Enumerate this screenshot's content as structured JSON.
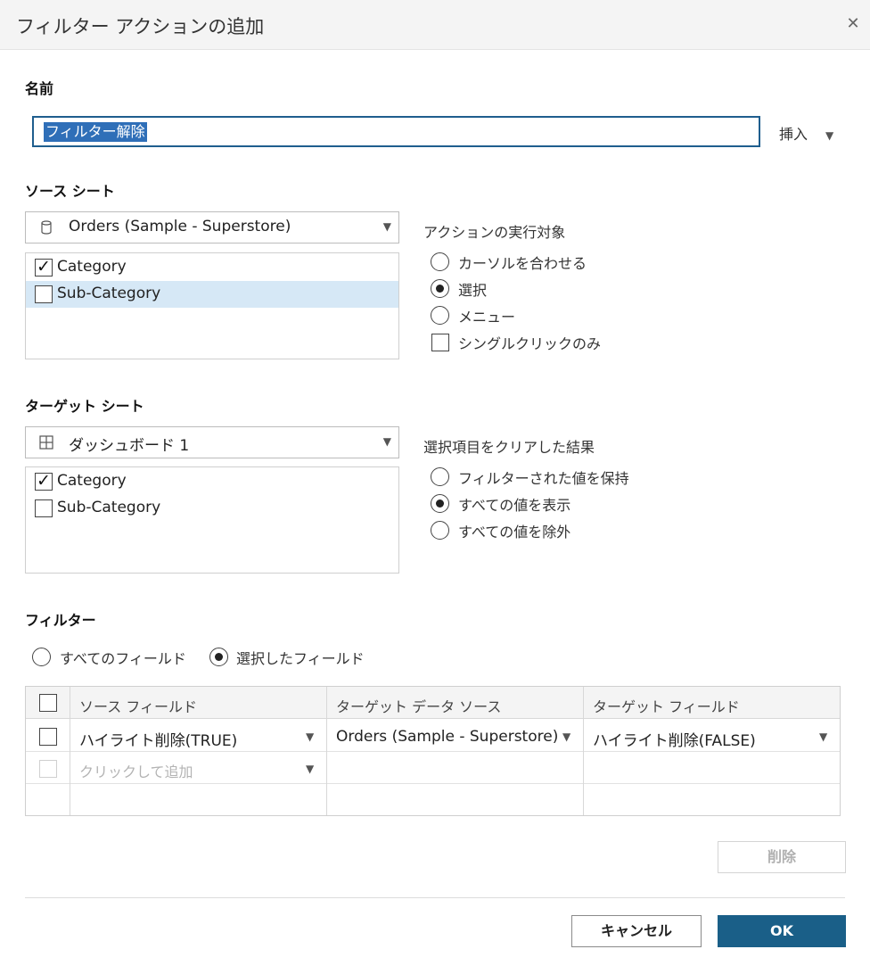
{
  "dialog": {
    "title": "フィルター アクションの追加",
    "close_glyph": "✕"
  },
  "name": {
    "label": "名前",
    "value": "フィルター解除",
    "insert_label": "挿入",
    "arrow": "▼"
  },
  "source": {
    "label": "ソース シート",
    "dropdown": {
      "icon": "database-icon",
      "value": "Orders (Sample - Superstore)",
      "arrow": "▼"
    },
    "items": [
      {
        "label": "Category",
        "checked": true
      },
      {
        "label": "Sub-Category",
        "checked": false
      }
    ],
    "run_on": {
      "heading": "アクションの実行対象",
      "options": [
        "カーソルを合わせる",
        "選択",
        "メニュー"
      ],
      "selected": "選択",
      "single_click_label": "シングルクリックのみ"
    }
  },
  "target": {
    "label": "ターゲット シート",
    "dropdown": {
      "icon": "dashboard-grid-icon",
      "value": "ダッシュボード 1",
      "arrow": "▼"
    },
    "items": [
      {
        "label": "Category",
        "checked": true
      },
      {
        "label": "Sub-Category",
        "checked": false
      }
    ],
    "clear": {
      "heading": "選択項目をクリアした結果",
      "options": [
        "フィルターされた値を保持",
        "すべての値を表示",
        "すべての値を除外"
      ],
      "selected": "すべての値を表示"
    }
  },
  "filter": {
    "label": "フィルター",
    "mode_options": [
      "すべてのフィールド",
      "選択したフィールド"
    ],
    "selected_mode": "選択したフィールド",
    "columns": [
      "ソース フィールド",
      "ターゲット データ ソース",
      "ターゲット フィールド"
    ],
    "rows": [
      {
        "source_field": "ハイライト削除(TRUE)",
        "target_source": "Orders (Sample - Superstore)",
        "target_field": "ハイライト削除(FALSE)"
      }
    ],
    "add_placeholder": "クリックして追加",
    "arrow": "▼"
  },
  "buttons": {
    "delete": "削除",
    "cancel": "キャンセル",
    "ok": "OK"
  }
}
